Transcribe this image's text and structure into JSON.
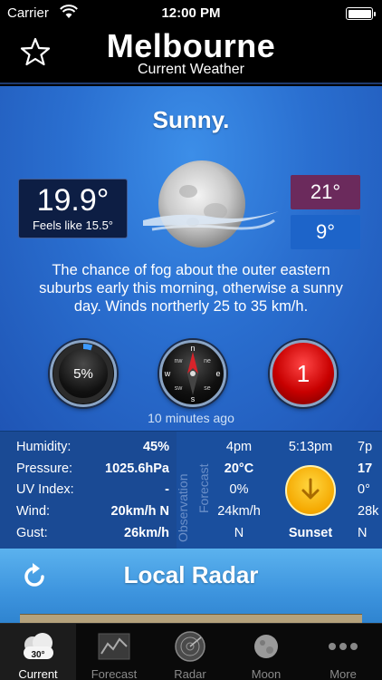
{
  "status": {
    "carrier": "Carrier",
    "time": "12:00 PM"
  },
  "nav": {
    "title": "Melbourne",
    "subtitle": "Current Weather"
  },
  "current": {
    "condition": "Sunny.",
    "temperature": "19.9°",
    "feels_like": "Feels like 15.5°",
    "max": "21°",
    "min": "9°",
    "description": "The chance of fog about the outer eastern suburbs early this morning, otherwise a sunny day. Winds northerly 25 to 35 km/h.",
    "rain_chance": "5%",
    "rain_chance_fraction": 0.05,
    "warnings": "1",
    "compass": {
      "n": "n",
      "e": "e",
      "s": "s",
      "w": "w",
      "nw": "nw",
      "ne": "ne",
      "se": "se",
      "sw": "sw"
    },
    "updated": "10 minutes ago"
  },
  "observation": {
    "side_label": "Observation",
    "rows": [
      {
        "label": "Humidity:",
        "value": "45%"
      },
      {
        "label": "Pressure:",
        "value": "1025.6hPa"
      },
      {
        "label": "UV Index:",
        "value": "-"
      },
      {
        "label": "Wind:",
        "value": "20km/h N"
      },
      {
        "label": "Gust:",
        "value": "26km/h"
      }
    ]
  },
  "forecast": {
    "side_label": "Forecast",
    "columns": [
      {
        "time": "4pm",
        "temp": "20°C",
        "rain": "0%",
        "wind": "24km/h",
        "dir": "N"
      },
      {
        "time": "5:13pm",
        "event": "Sunset"
      },
      {
        "time": "7p",
        "temp": "17",
        "rain": "0°",
        "wind": "28k",
        "dir": "N"
      }
    ]
  },
  "radar": {
    "title": "Local Radar"
  },
  "tabs": [
    {
      "label": "Current",
      "badge": "30°",
      "icon": "cloud-icon"
    },
    {
      "label": "Forecast",
      "icon": "chart-icon"
    },
    {
      "label": "Radar",
      "icon": "radar-icon"
    },
    {
      "label": "Moon",
      "icon": "moon-icon"
    },
    {
      "label": "More",
      "icon": "more-icon"
    }
  ],
  "colors": {
    "max": "#6b2a5c",
    "min": "#1d64c9",
    "main_blue": "#2a6fd0"
  }
}
